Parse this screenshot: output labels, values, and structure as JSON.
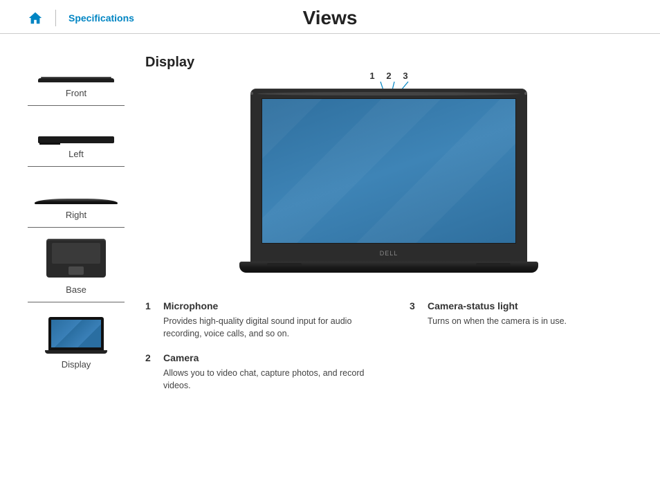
{
  "header": {
    "home_label": "Home",
    "specs_link": "Specifications",
    "title": "Views"
  },
  "sidebar": {
    "items": [
      {
        "label": "Front"
      },
      {
        "label": "Left"
      },
      {
        "label": "Right"
      },
      {
        "label": "Base"
      },
      {
        "label": "Display"
      }
    ]
  },
  "main": {
    "heading": "Display",
    "brand_logo_text": "DELL",
    "callouts": [
      "1",
      "2",
      "3"
    ],
    "features_left": [
      {
        "num": "1",
        "title": "Microphone",
        "desc": "Provides high-quality digital sound input for audio recording, voice calls, and so on."
      },
      {
        "num": "2",
        "title": "Camera",
        "desc": "Allows you to video chat, capture photos, and record videos."
      }
    ],
    "features_right": [
      {
        "num": "3",
        "title": "Camera-status light",
        "desc": "Turns on when the camera is in use."
      }
    ]
  }
}
